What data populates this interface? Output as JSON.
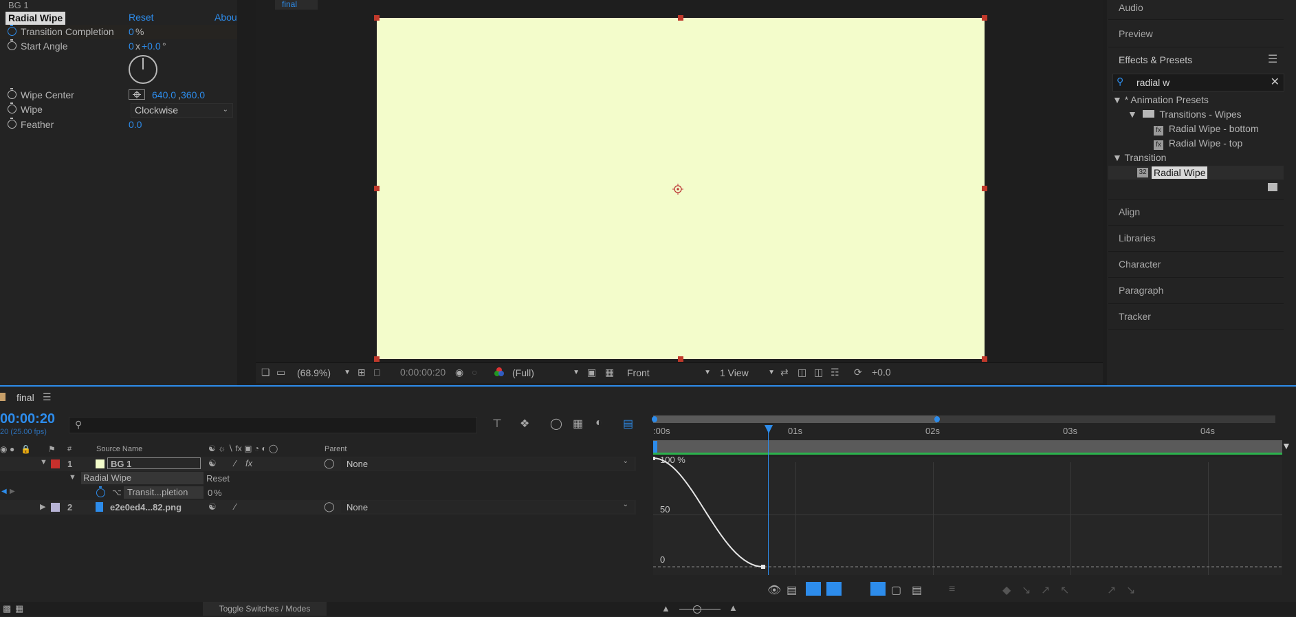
{
  "effect_controls": {
    "layer_name": "BG 1",
    "effect_name": "Radial Wipe",
    "reset_label": "Reset",
    "about_label": "Abou",
    "properties": [
      {
        "name": "Transition Completion",
        "value": "0",
        "unit": "%"
      },
      {
        "name": "Start Angle",
        "value_prefix": "0",
        "value_x": "x",
        "value": "+0.0",
        "unit": "°"
      },
      {
        "name": "Wipe Center",
        "value": "640.0",
        "value2": "360.0",
        "separator": ","
      },
      {
        "name": "Wipe",
        "value": "Clockwise"
      },
      {
        "name": "Feather",
        "value": "0.0"
      }
    ]
  },
  "viewer": {
    "tab_label": "final",
    "canvas_color": "#f3fccb",
    "toolbar": {
      "zoom": "(68.9%)",
      "timecode": "0:00:00:20",
      "resolution": "(Full)",
      "view": "Front",
      "views": "1 View",
      "exposure": "+0.0"
    }
  },
  "right_panels": {
    "audio": "Audio",
    "preview": "Preview",
    "effects_presets": {
      "title": "Effects & Presets",
      "search_value": "radial w",
      "tree": [
        {
          "label": "* Animation Presets",
          "level": 0,
          "type": "group"
        },
        {
          "label": "Transitions - Wipes",
          "level": 1,
          "type": "folder"
        },
        {
          "label": "Radial Wipe - bottom",
          "level": 2,
          "type": "preset"
        },
        {
          "label": "Radial Wipe - top",
          "level": 2,
          "type": "preset"
        },
        {
          "label": "Transition",
          "level": 0,
          "type": "group"
        },
        {
          "label": "Radial Wipe",
          "level": 1,
          "type": "effect",
          "badge": "32"
        }
      ]
    },
    "other_panels": [
      "Align",
      "Libraries",
      "Character",
      "Paragraph",
      "Tracker"
    ]
  },
  "timeline": {
    "comp_name": "final",
    "timecode": "00:00:20",
    "fps_label": "20 (25.00 fps)",
    "columns": {
      "number": "#",
      "source_name": "Source Name",
      "parent": "Parent"
    },
    "layers": [
      {
        "index": "1",
        "name": "BG 1",
        "color": "#f3fccb",
        "label_color": "#c9302c",
        "parent": "None"
      },
      {
        "index": "2",
        "name": "e2e0ed4...82.png",
        "color": "#b8b4d6",
        "label_color": "#b8b4d6",
        "parent": "None"
      }
    ],
    "effect_row": {
      "name": "Radial Wipe",
      "reset": "Reset"
    },
    "property_row": {
      "name": "Transit...pletion",
      "value": "0",
      "unit": "%"
    },
    "ruler_labels": [
      ":00s",
      "01s",
      "02s",
      "03s",
      "04s"
    ],
    "graph_labels": {
      "top": "100 %",
      "mid": "50",
      "bottom": "0"
    },
    "toggle_label": "Toggle Switches / Modes"
  },
  "chart_data": {
    "type": "line",
    "x": [
      0,
      0.2,
      0.4,
      0.6,
      0.8
    ],
    "series": [
      {
        "values": [
          100,
          85,
          50,
          15,
          0
        ]
      }
    ],
    "xlabel": "",
    "ylabel": "",
    "ylim": [
      0,
      100
    ]
  }
}
